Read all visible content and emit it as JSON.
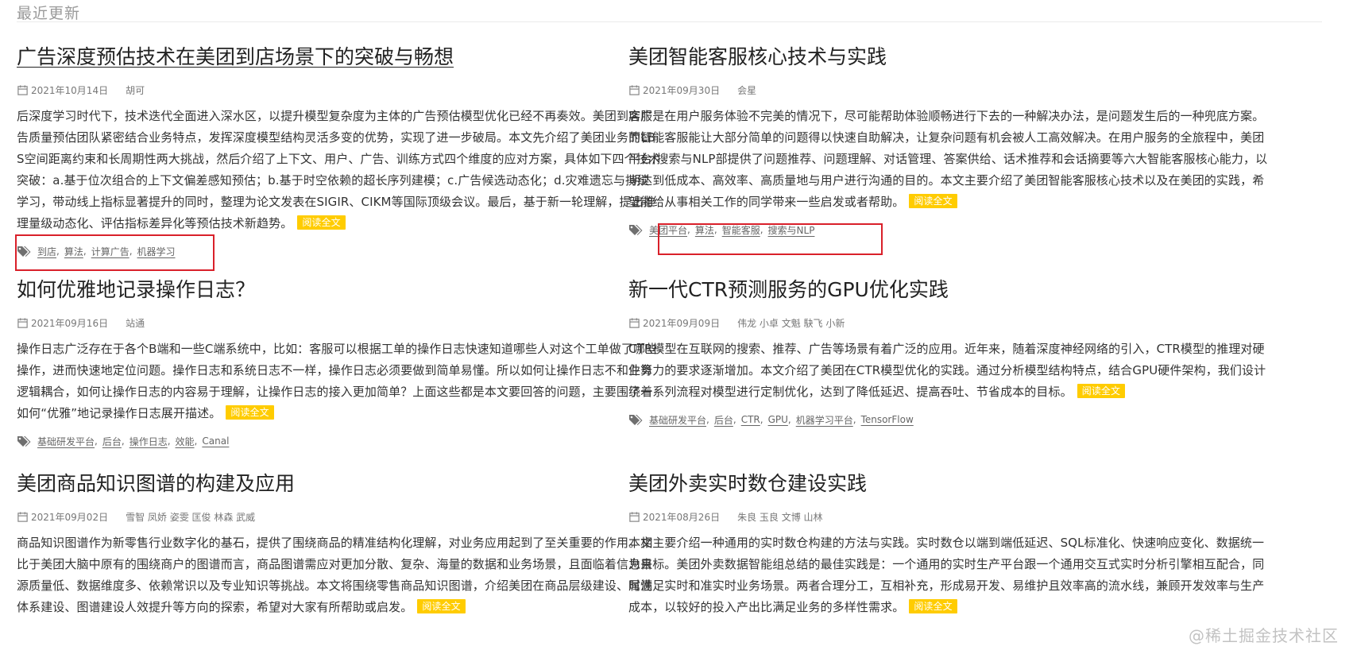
{
  "section": {
    "title": "最近更新"
  },
  "read_more_label": "阅读全文",
  "colors": {
    "read_more_bg": "#ffcc00",
    "highlight_border": "#d9202a"
  },
  "posts": [
    {
      "title": "广告深度预估技术在美团到店场景下的突破与畅想",
      "date": "2021年10月14日",
      "author": "胡可",
      "excerpt": "后深度学习时代下，技术迭代全面进入深水区，以提升模型复杂度为主体的广告预估模型优化已经不再奏效。美团到店广告质量预估团队紧密结合业务特点，发挥深度模型结构灵活多变的优势，实现了进一步破局。本文先介绍了美团业务的LBS空间距离约束和长周期性两大挑战，然后介绍了上下文、用户、广告、训练方式四个维度的应对方案，具体如下四个技术突破：a.基于位次组合的上下文偏差感知预估；b.基于时空依赖的超长序列建模；c.广告候选动态化；d.灾难遗忘与持续学习，带动线上指标显著提升的同时，整理为论文发表在SIGIR、CIKM等国际顶级会议。最后，基于新一轮理解，提出推理量级动态化、评估指标差异化等预估技术新趋势。",
      "tags": [
        "到店",
        "算法",
        "计算广告",
        "机器学习"
      ]
    },
    {
      "title": "美团智能客服核心技术与实践",
      "date": "2021年09月30日",
      "author": "会星",
      "excerpt": "客服是在用户服务体验不完美的情况下，尽可能帮助体验顺畅进行下去的一种解决办法，是问题发生后的一种兜底方案。而智能客服能让大部分简单的问题得以快速自助解决，让复杂问题有机会被人工高效解决。在用户服务的全旅程中，美团平台/搜索与NLP部提供了问题推荐、问题理解、对话管理、答案供给、话术推荐和会话摘要等六大智能客服核心能力，以期达到低成本、高效率、高质量地与用户进行沟通的目的。本文主要介绍了美团智能客服核心技术以及在美团的实践，希望能给从事相关工作的同学带来一些启发或者帮助。",
      "tags": [
        "美团平台",
        "算法",
        "智能客服",
        "搜索与NLP"
      ]
    },
    {
      "title": "如何优雅地记录操作日志？",
      "date": "2021年09月16日",
      "author": "站通",
      "excerpt": "操作日志广泛存在于各个B端和一些C端系统中，比如：客服可以根据工单的操作日志快速知道哪些人对这个工单做了哪些操作，进而快速地定位问题。操作日志和系统日志不一样，操作日志必须要做到简单易懂。所以如何让操作日志不和业务逻辑耦合，如何让操作日志的内容易于理解，让操作日志的接入更加简单？上面这些都是本文要回答的问题，主要围绕着如何“优雅”地记录操作日志展开描述。",
      "tags": [
        "基础研发平台",
        "后台",
        "操作日志",
        "效能",
        "Canal"
      ]
    },
    {
      "title": "新一代CTR预测服务的GPU优化实践",
      "date": "2021年09月09日",
      "author": "伟龙 小卓 文魁 駃飞 小新",
      "excerpt": "CTR模型在互联网的搜索、推荐、广告等场景有着广泛的应用。近年来，随着深度神经网络的引入，CTR模型的推理对硬件算力的要求逐渐增加。本文介绍了美团在CTR模型优化的实践。通过分析模型结构特点，结合GPU硬件架构，我们设计了一系列流程对模型进行定制优化，达到了降低延迟、提高吞吐、节省成本的目标。",
      "tags": [
        "基础研发平台",
        "后台",
        "CTR",
        "GPU",
        "机器学习平台",
        "TensorFlow"
      ]
    },
    {
      "title": "美团商品知识图谱的构建及应用",
      "date": "2021年09月02日",
      "author": "雪智 凤娇 姿雯 匡俊 林森 武威",
      "excerpt": "商品知识图谱作为新零售行业数字化的基石，提供了围绕商品的精准结构化理解，对业务应用起到了至关重要的作用。相比于美团大脑中原有的围绕商户的图谱而言，商品图谱需应对更加分散、复杂、海量的数据和业务场景，且面临着信息来源质量低、数据维度多、依赖常识以及专业知识等挑战。本文将围绕零售商品知识图谱，介绍美团在商品层级建设、属性体系建设、图谱建设人效提升等方向的探索，希望对大家有所帮助或启发。",
      "tags": []
    },
    {
      "title": "美团外卖实时数仓建设实践",
      "date": "2021年08月26日",
      "author": "朱良 玉良 文博 山林",
      "excerpt": "本文主要介绍一种通用的实时数仓构建的方法与实践。实时数仓以端到端低延迟、SQL标准化、快速响应变化、数据统一为目标。美团外卖数据智能组总结的最佳实践是：一个通用的实时生产平台跟一个通用交互式实时分析引擎相互配合，同时满足实时和准实时业务场景。两者合理分工，互相补充，形成易开发、易维护且效率高的流水线，兼顾开发效率与生产成本，以较好的投入产出比满足业务的多样性需求。",
      "tags": []
    }
  ],
  "watermark": "@稀土掘金技术社区"
}
